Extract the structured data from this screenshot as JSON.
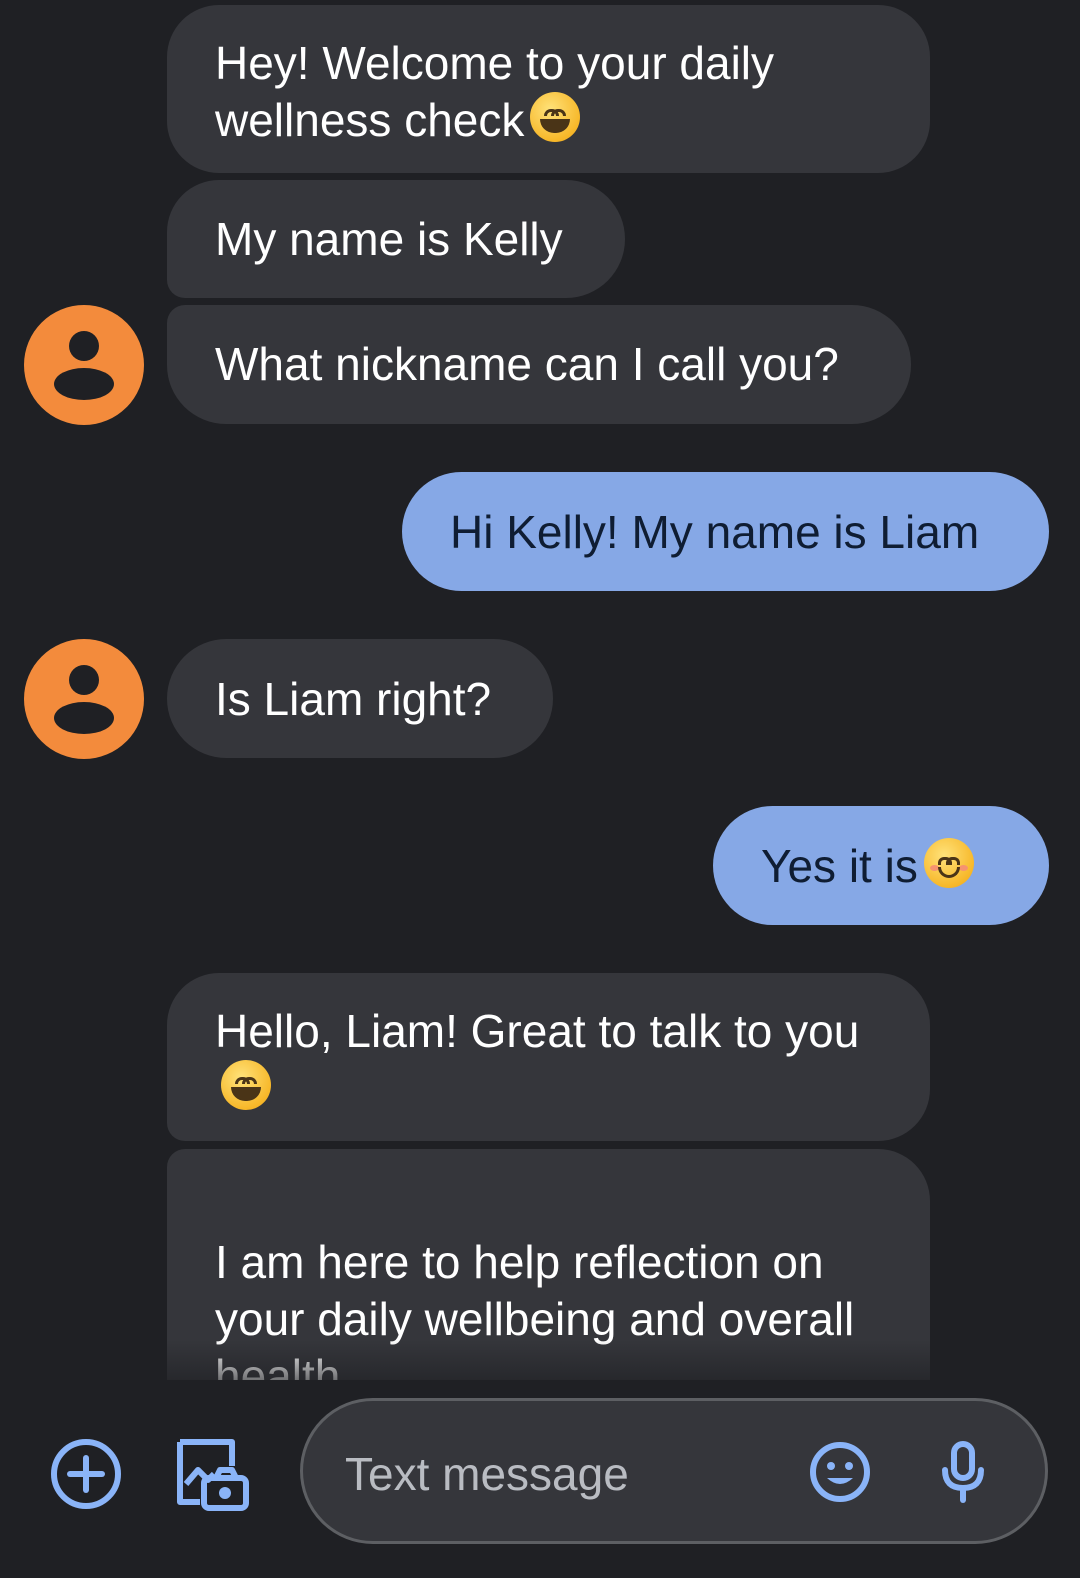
{
  "thread": {
    "messages": [
      {
        "from": "bot",
        "text": "Hey! Welcome to your daily wellness check",
        "emoji": "grinning-face-emoji"
      },
      {
        "from": "bot",
        "text": "My name is Kelly"
      },
      {
        "from": "bot",
        "text": "What nickname can I call you?"
      },
      {
        "from": "user",
        "text": "Hi Kelly! My name is Liam"
      },
      {
        "from": "bot",
        "text": "Is Liam right?"
      },
      {
        "from": "user",
        "text": "Yes it is",
        "emoji": "smiling-face-with-smiling-eyes-emoji"
      },
      {
        "from": "bot",
        "text": "Hello, Liam! Great to talk to you",
        "emoji": "grinning-squinting-face-emoji"
      },
      {
        "from": "bot",
        "text": "I am here to help reflection on your daily wellbeing and overall health.\nAlthough I can understand"
      }
    ],
    "avatar_color": "#f38b3c",
    "incoming_bubble_color": "#35363b",
    "outgoing_bubble_color": "#86a8e6"
  },
  "compose": {
    "add_icon": "add-circle-icon",
    "gallery_icon": "gallery-camera-icon",
    "placeholder": "Text message",
    "emoji_icon": "emoji-icon",
    "mic_icon": "microphone-icon",
    "accent_color": "#8ab4f8"
  }
}
